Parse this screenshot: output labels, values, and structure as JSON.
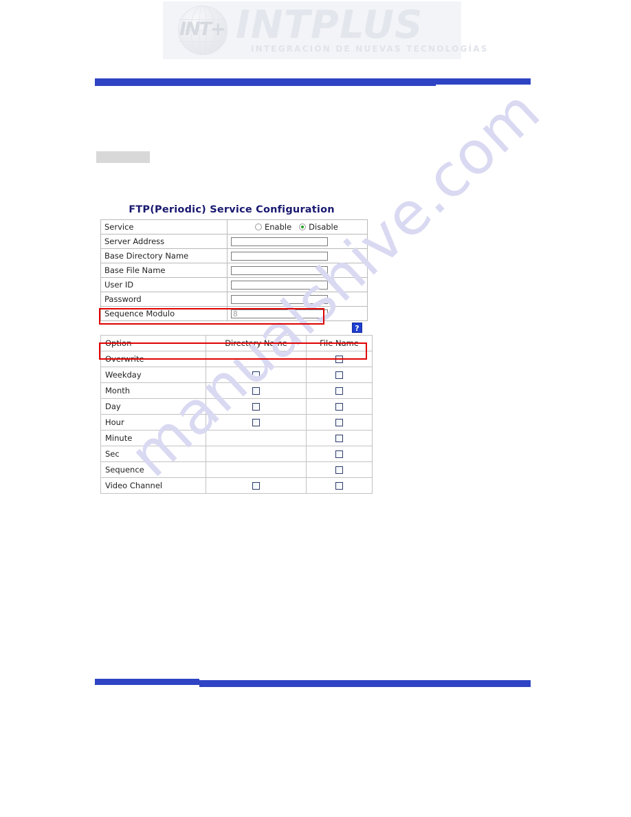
{
  "brand": {
    "mark": "INT+",
    "wordmark": "INTPLUS",
    "tagline": "INTEGRACIÓN DE NUEVAS TECNOLOGÍAS"
  },
  "watermark": {
    "text": "manualshive.com",
    "color": "#d9d9f2"
  },
  "colors": {
    "rule_blue": "#2f44c4",
    "title_navy": "#191970",
    "highlight_red": "#e00000",
    "radio_green": "#1f9e1f",
    "help_blue": "#1f3fd0",
    "grey_box": "#d8d8d8"
  },
  "form": {
    "title": "FTP(Periodic) Service Configuration",
    "rows": [
      {
        "label": "Service",
        "type": "radio",
        "options": [
          {
            "label": "Enable",
            "selected": false
          },
          {
            "label": "Disable",
            "selected": true
          }
        ]
      },
      {
        "label": "Server Address",
        "type": "text",
        "value": "",
        "placeholder": ""
      },
      {
        "label": "Base Directory Name",
        "type": "text",
        "value": "",
        "placeholder": ""
      },
      {
        "label": "Base File Name",
        "type": "text",
        "value": "",
        "placeholder": ""
      },
      {
        "label": "User ID",
        "type": "text",
        "value": "",
        "placeholder": ""
      },
      {
        "label": "Password",
        "type": "text",
        "value": "",
        "placeholder": ""
      },
      {
        "label": "Sequence Modulo",
        "type": "text",
        "value": "8",
        "placeholder": "8"
      }
    ]
  },
  "help": {
    "glyph": "?",
    "label": "help-button"
  },
  "option_table": {
    "headers": [
      "Option",
      "Directory Name",
      "File Name"
    ],
    "rows": [
      {
        "option": "Overwrite",
        "directory": false,
        "directory_shown": false,
        "file": false,
        "file_shown": true
      },
      {
        "option": "Weekday",
        "directory": false,
        "directory_shown": true,
        "file": false,
        "file_shown": true
      },
      {
        "option": "Month",
        "directory": false,
        "directory_shown": true,
        "file": false,
        "file_shown": true
      },
      {
        "option": "Day",
        "directory": false,
        "directory_shown": true,
        "file": false,
        "file_shown": true
      },
      {
        "option": "Hour",
        "directory": false,
        "directory_shown": true,
        "file": false,
        "file_shown": true
      },
      {
        "option": "Minute",
        "directory": false,
        "directory_shown": false,
        "file": false,
        "file_shown": true
      },
      {
        "option": "Sec",
        "directory": false,
        "directory_shown": false,
        "file": false,
        "file_shown": true
      },
      {
        "option": "Sequence",
        "directory": false,
        "directory_shown": false,
        "file": false,
        "file_shown": true
      },
      {
        "option": "Video Channel",
        "directory": false,
        "directory_shown": true,
        "file": false,
        "file_shown": true
      }
    ]
  },
  "annotations": [
    {
      "name": "sequence-modulo-highlight",
      "target": "Sequence Modulo"
    },
    {
      "name": "overwrite-row-highlight",
      "target": "Overwrite"
    }
  ]
}
